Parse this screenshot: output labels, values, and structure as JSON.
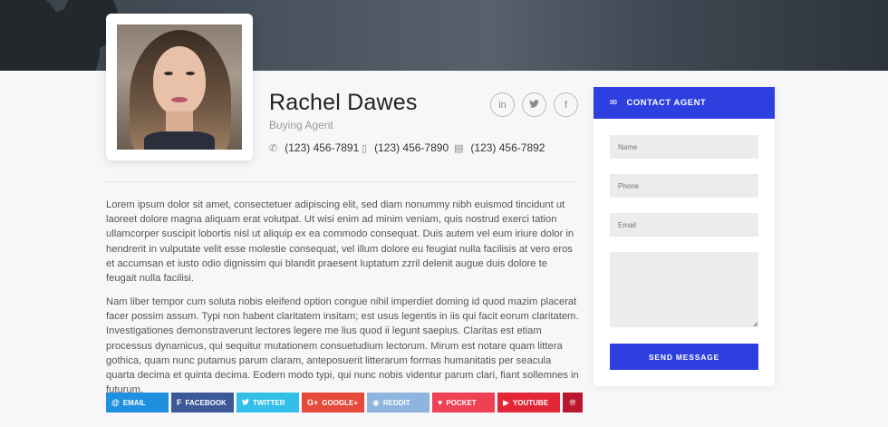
{
  "agent": {
    "name": "Rachel Dawes",
    "role": "Buying Agent",
    "phones": [
      {
        "icon": "phone-icon",
        "number": "(123) 456-7891"
      },
      {
        "icon": "mobile-icon",
        "number": "(123) 456-7890"
      },
      {
        "icon": "fax-icon",
        "number": "(123) 456-7892"
      }
    ],
    "social": [
      {
        "icon": "linkedin-icon",
        "glyph": "in"
      },
      {
        "icon": "twitter-icon",
        "glyph": "🐦"
      },
      {
        "icon": "facebook-icon",
        "glyph": "f"
      }
    ]
  },
  "bio": {
    "paragraph1": "Lorem ipsum dolor sit amet, consectetuer adipiscing elit, sed diam nonummy nibh euismod tincidunt ut laoreet dolore magna aliquam erat volutpat. Ut wisi enim ad minim veniam, quis nostrud exerci tation ullamcorper suscipit lobortis nisl ut aliquip ex ea commodo consequat. Duis autem vel eum iriure dolor in hendrerit in vulputate velit esse molestie consequat, vel illum dolore eu feugiat nulla facilisis at vero eros et accumsan et iusto odio dignissim qui blandit praesent luptatum zzril delenit augue duis dolore te feugait nulla facilisi.",
    "paragraph2": "Nam liber tempor cum soluta nobis eleifend option congue nihil imperdiet doming id quod mazim placerat facer possim assum. Typi non habent claritatem insitam; est usus legentis in iis qui facit eorum claritatem. Investigationes demonstraverunt lectores legere me lius quod ii legunt saepius. Claritas est etiam processus dynamicus, qui sequitur mutationem consuetudium lectorum. Mirum est notare quam littera gothica, quam nunc putamus parum claram, anteposuerit litterarum formas humanitatis per seacula quarta decima et quinta decima. Eodem modo typi, qui nunc nobis videntur parum clari, fiant sollemnes in futurum."
  },
  "share": {
    "email": "EMAIL",
    "facebook": "FACEBOOK",
    "twitter": "TWITTER",
    "google": "GOOGLE+",
    "reddit": "REDDIT",
    "pocket": "POCKET",
    "youtube": "YOUTUBE"
  },
  "contact": {
    "title": "CONTACT AGENT",
    "name_placeholder": "Name",
    "phone_placeholder": "Phone",
    "email_placeholder": "Email",
    "message_placeholder": "",
    "send_label": "SEND MESSAGE"
  },
  "colors": {
    "accent": "#2e3fe0",
    "email": "#1f8fe0",
    "facebook": "#3b5998",
    "twitter": "#33bfe8",
    "google": "#e5493a",
    "reddit": "#8fb4de",
    "pocket": "#ef4056",
    "youtube": "#e32636",
    "pinterest": "#b8172e"
  }
}
